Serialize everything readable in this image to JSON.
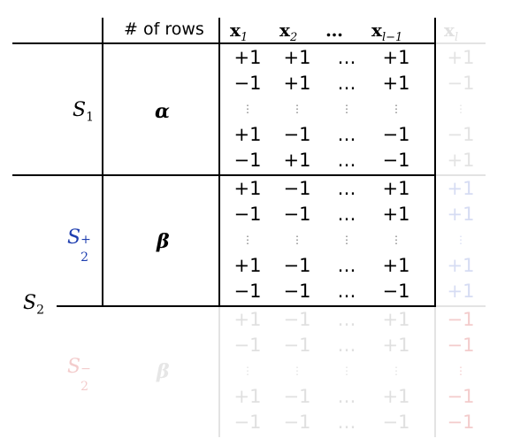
{
  "header": {
    "rows_label": "# of rows",
    "columns": [
      {
        "base": "x",
        "sub": "1"
      },
      {
        "base": "x",
        "sub": "2"
      },
      {
        "base": "…",
        "sub": ""
      },
      {
        "base": "x",
        "sub": "l−1"
      },
      {
        "base": "x",
        "sub": "l"
      }
    ]
  },
  "groups": [
    {
      "label_main": "S",
      "label_sub": "1",
      "label_sup": "",
      "count": "α",
      "rows": [
        [
          "+1",
          "+1",
          "…",
          "+1",
          "+1"
        ],
        [
          "−1",
          "+1",
          "…",
          "+1",
          "−1"
        ],
        [
          "⋮",
          "⋮",
          "⋮",
          "⋮",
          "⋮"
        ],
        [
          "+1",
          "−1",
          "…",
          "−1",
          "−1"
        ],
        [
          "−1",
          "+1",
          "…",
          "−1",
          "+1"
        ]
      ]
    },
    {
      "label_main": "S",
      "label_sub": "2",
      "label_sup": "+",
      "count": "β",
      "rows": [
        [
          "+1",
          "−1",
          "…",
          "+1",
          "+1"
        ],
        [
          "−1",
          "−1",
          "…",
          "+1",
          "+1"
        ],
        [
          "⋮",
          "⋮",
          "⋮",
          "⋮",
          "⋮"
        ],
        [
          "+1",
          "−1",
          "…",
          "+1",
          "+1"
        ],
        [
          "−1",
          "−1",
          "…",
          "−1",
          "+1"
        ]
      ]
    },
    {
      "label_main": "S",
      "label_sub": "2",
      "label_sup": "−",
      "count": "β",
      "rows": [
        [
          "+1",
          "−1",
          "…",
          "+1",
          "−1"
        ],
        [
          "−1",
          "−1",
          "…",
          "+1",
          "−1"
        ],
        [
          "⋮",
          "⋮",
          "⋮",
          "⋮",
          "⋮"
        ],
        [
          "+1",
          "−1",
          "…",
          "+1",
          "−1"
        ],
        [
          "−1",
          "−1",
          "…",
          "−1",
          "−1"
        ]
      ]
    }
  ],
  "outer_label": {
    "main": "S",
    "sub": "2"
  },
  "colors": {
    "default": "#000000",
    "s2_plus": "#1f3fb0",
    "s2_minus": "#f3cccc",
    "faded_text": "#e0e0e0",
    "last_col_blue": "#d6dcf3",
    "last_col_red": "#f3cccc",
    "last_col_gray": "#e3e3e3"
  }
}
